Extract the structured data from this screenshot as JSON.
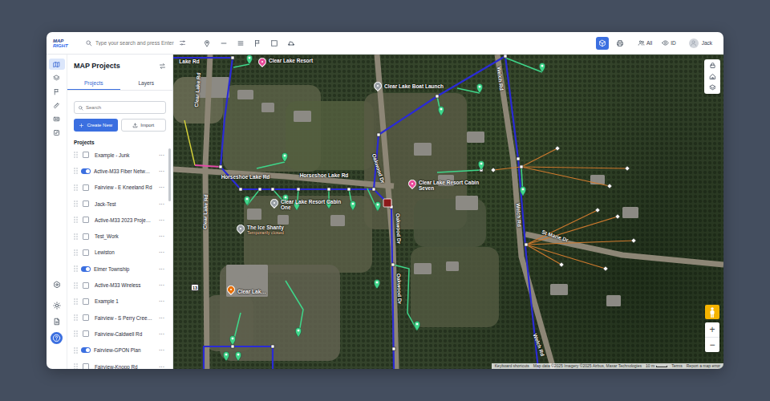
{
  "logo": {
    "top": "MAP",
    "bottom": "RIGHT"
  },
  "search": {
    "placeholder": "Type your search and press Enter"
  },
  "toolbar": {
    "view_buttons": [
      {
        "selected": true
      },
      {
        "selected": false
      }
    ],
    "filters": [
      {
        "label": "All"
      },
      {
        "label": "ID"
      }
    ],
    "user": {
      "name": "Jack"
    }
  },
  "rail": {
    "items": [
      {
        "selected": true
      },
      {
        "selected": false
      },
      {
        "selected": false
      },
      {
        "selected": false
      },
      {
        "selected": false
      },
      {
        "selected": false
      }
    ]
  },
  "sidebar": {
    "title": "MAP Projects",
    "tabs": [
      {
        "label": "Projects",
        "selected": true
      },
      {
        "label": "Layers",
        "selected": false
      }
    ],
    "search": {
      "placeholder": "Search"
    },
    "create_button": "Create New",
    "import_button": "Import",
    "section": "Projects",
    "more_glyph": "···",
    "scroll": {
      "level": 0.24
    },
    "projects": [
      {
        "name": "Example - Junk",
        "on": false
      },
      {
        "name": "Active-M33 Fiber Netw…",
        "on": true
      },
      {
        "name": "Fairview - E Kneeland Rd",
        "on": false
      },
      {
        "name": "Jack-Test",
        "on": false
      },
      {
        "name": "Active-M33 2023 Proje…",
        "on": false
      },
      {
        "name": "Test_Work",
        "on": false
      },
      {
        "name": "Lewiston",
        "on": false
      },
      {
        "name": "Elmer Township",
        "on": true
      },
      {
        "name": "Active-M33 Wireless",
        "on": false
      },
      {
        "name": "Example 1",
        "on": false
      },
      {
        "name": "Fairview - S Perry Cree…",
        "on": false
      },
      {
        "name": "Fairview-Caldwell Rd",
        "on": false
      },
      {
        "name": "Fairview-GPON Plan",
        "on": true
      },
      {
        "name": "Fairview-Knopp Rd",
        "on": false
      }
    ]
  },
  "map": {
    "road_labels": [
      {
        "text": "Lake Rd"
      },
      {
        "text": "Clear Lake Rd"
      },
      {
        "text": "Clear Lake Rd"
      },
      {
        "text": "Horseshoe Lake Rd"
      },
      {
        "text": "Horseshoe Lake Rd"
      },
      {
        "text": "Oakwood Dr"
      },
      {
        "text": "Oakwood Dr"
      },
      {
        "text": "Oakwood Dr"
      },
      {
        "text": "Welch Rd"
      },
      {
        "text": "Welch Rd"
      },
      {
        "text": "Welch Rd"
      },
      {
        "text": "St Marie Dr"
      }
    ],
    "pois": [
      {
        "name": "Clear Lake Resort",
        "sub": "",
        "color": "#e84c9b"
      },
      {
        "name": "Clear Lake Boat Launch",
        "sub": "",
        "color": "#9aa0a6"
      },
      {
        "name": "Clear Lake Resort Cabin Seven",
        "sub": "",
        "color": "#e84c9b"
      },
      {
        "name": "Clear Lake Resort Cabin One",
        "sub": "",
        "color": "#9aa0a6"
      },
      {
        "name": "The Ice Shanty",
        "sub": "Temporarily closed",
        "color": "#9aa0a6"
      },
      {
        "name": "Clear Lak…",
        "sub": "",
        "color": "#e8710a"
      }
    ],
    "route_shield": "13",
    "zoom": {
      "in": "+",
      "out": "−"
    },
    "attribution": [
      "Keyboard shortcuts",
      "Map data ©2025 Imagery ©2025 Airbus, Maxar Technologies",
      "10 m",
      "Terms",
      "Report a map error"
    ]
  }
}
